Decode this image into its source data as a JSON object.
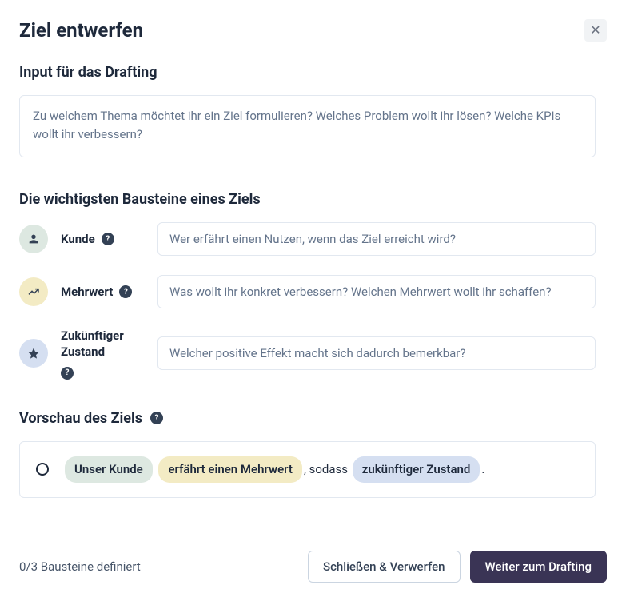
{
  "header": {
    "title": "Ziel entwerfen"
  },
  "input_section": {
    "title": "Input für das Drafting",
    "placeholder": "Zu welchem Thema möchtet ihr ein Ziel formulieren? Welches Problem wollt ihr lösen? Welche KPIs wollt ihr verbessern?"
  },
  "blocks_section": {
    "title": "Die wichtigsten Bausteine eines Ziels",
    "items": [
      {
        "label": "Kunde",
        "placeholder": "Wer erfährt einen Nutzen, wenn das Ziel erreicht wird?"
      },
      {
        "label": "Mehrwert",
        "placeholder": "Was wollt ihr konkret verbessern? Welchen Mehrwert wollt ihr schaffen?"
      },
      {
        "label": "Zukünftiger Zustand",
        "placeholder": "Welcher positive Effekt macht sich dadurch bemerkbar?"
      }
    ]
  },
  "preview": {
    "title": "Vorschau des Ziels",
    "chip_kunde": "Unser Kunde",
    "chip_mehrwert": "erfährt einen Mehrwert",
    "connector": ", sodass",
    "chip_zustand": "zukünftiger Zustand",
    "end": "."
  },
  "footer": {
    "counter": "0/3 Bausteine definiert",
    "cancel": "Schließen & Verwerfen",
    "continue": "Weiter zum Drafting"
  }
}
